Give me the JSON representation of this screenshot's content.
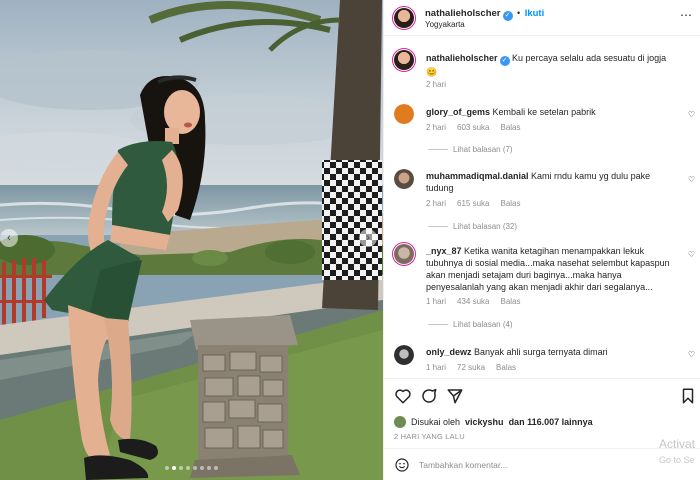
{
  "header": {
    "username": "nathalieholscher",
    "follow_label": "Ikuti",
    "location": "Yogyakarta",
    "separator": "•"
  },
  "caption": {
    "username": "nathalieholscher",
    "text": "Ku percaya selalu ada sesuatu di jogja 😊",
    "time": "2 hari"
  },
  "comments": [
    {
      "username": "glory_of_gems",
      "text": "Kembali ke setelan pabrik",
      "time": "2 hari",
      "likes": "603 suka",
      "reply": "Balas",
      "replies_label": "Lihat balasan (7)",
      "avatar_color": "#e07b1f"
    },
    {
      "username": "muhammadiqmal.danial",
      "text": "Kami rndu kamu yg dulu pake tudung",
      "time": "2 hari",
      "likes": "615 suka",
      "reply": "Balas",
      "replies_label": "Lihat balasan (32)",
      "avatar_color": "#8a7a6c"
    },
    {
      "username": "_nyx_87",
      "text": "Ketika wanita ketagihan menampakkan lekuk tubuhnya di sosial media...maka nasehat selembut kapaspun akan menjadi setajam duri baginya...maka hanya penyesalanlah yang akan menjadi akhir dari segalanya...",
      "time": "1 hari",
      "likes": "434 suka",
      "reply": "Balas",
      "replies_label": "Lihat balasan (4)",
      "avatar_color": "#b9a89a"
    },
    {
      "username": "only_dewz",
      "text": "Banyak ahli surga ternyata dimari",
      "time": "1 hari",
      "likes": "72 suka",
      "reply": "Balas",
      "replies_label": "",
      "avatar_color": "#3b3b3b"
    }
  ],
  "likes": {
    "prefix": "Disukai oleh",
    "user": "vickyshu",
    "suffix": "dan 116.007 lainnya"
  },
  "posted_ago": "2 HARI YANG LALU",
  "add_comment": {
    "placeholder": "Tambahkan komentar..."
  },
  "watermark": {
    "line1": "Activat",
    "line2": "Go to Se"
  },
  "carousel": {
    "prev_icon": "chevron-left-icon",
    "next_icon": "chevron-right-icon",
    "current": 2,
    "total": 8
  },
  "colors": {
    "accent": "#0095f6",
    "verified": "#3897f0",
    "muted": "#8e8e8e"
  }
}
